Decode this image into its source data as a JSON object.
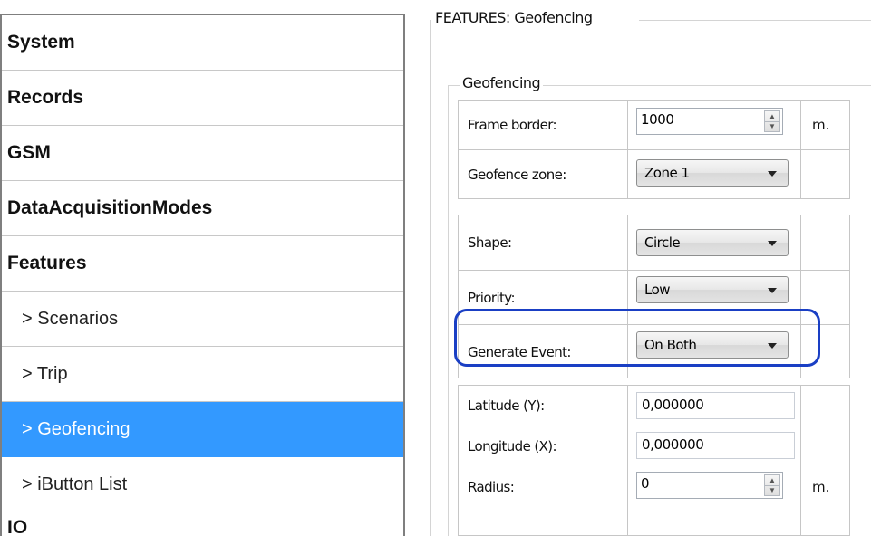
{
  "sidebar": {
    "items": [
      {
        "label": "System"
      },
      {
        "label": "Records"
      },
      {
        "label": "GSM"
      },
      {
        "label": "DataAcquisitionModes"
      },
      {
        "label": "Features"
      },
      {
        "label": "> Scenarios"
      },
      {
        "label": "> Trip"
      },
      {
        "label": "> Geofencing"
      },
      {
        "label": "> iButton List"
      },
      {
        "label": "IO"
      }
    ],
    "selected": "> Geofencing",
    "selected_color": "#3399ff"
  },
  "panel": {
    "group_title": "FEATURES: Geofencing",
    "inner_title": "Geofencing",
    "frame_border": {
      "label": "Frame border:",
      "value": "1000",
      "unit": "m."
    },
    "geofence_zone": {
      "label": "Geofence zone:",
      "value": "Zone 1"
    },
    "shape": {
      "label": "Shape:",
      "value": "Circle"
    },
    "priority": {
      "label": "Priority:",
      "value": "Low"
    },
    "generate_event": {
      "label": "Generate Event:",
      "value": "On Both"
    },
    "latitude": {
      "label": "Latitude (Y):",
      "value": "0,000000"
    },
    "longitude": {
      "label": "Longitude (X):",
      "value": "0,000000"
    },
    "radius": {
      "label": "Radius:",
      "value": "0",
      "unit": "m."
    },
    "highlight_color": "#1a3fc4"
  }
}
